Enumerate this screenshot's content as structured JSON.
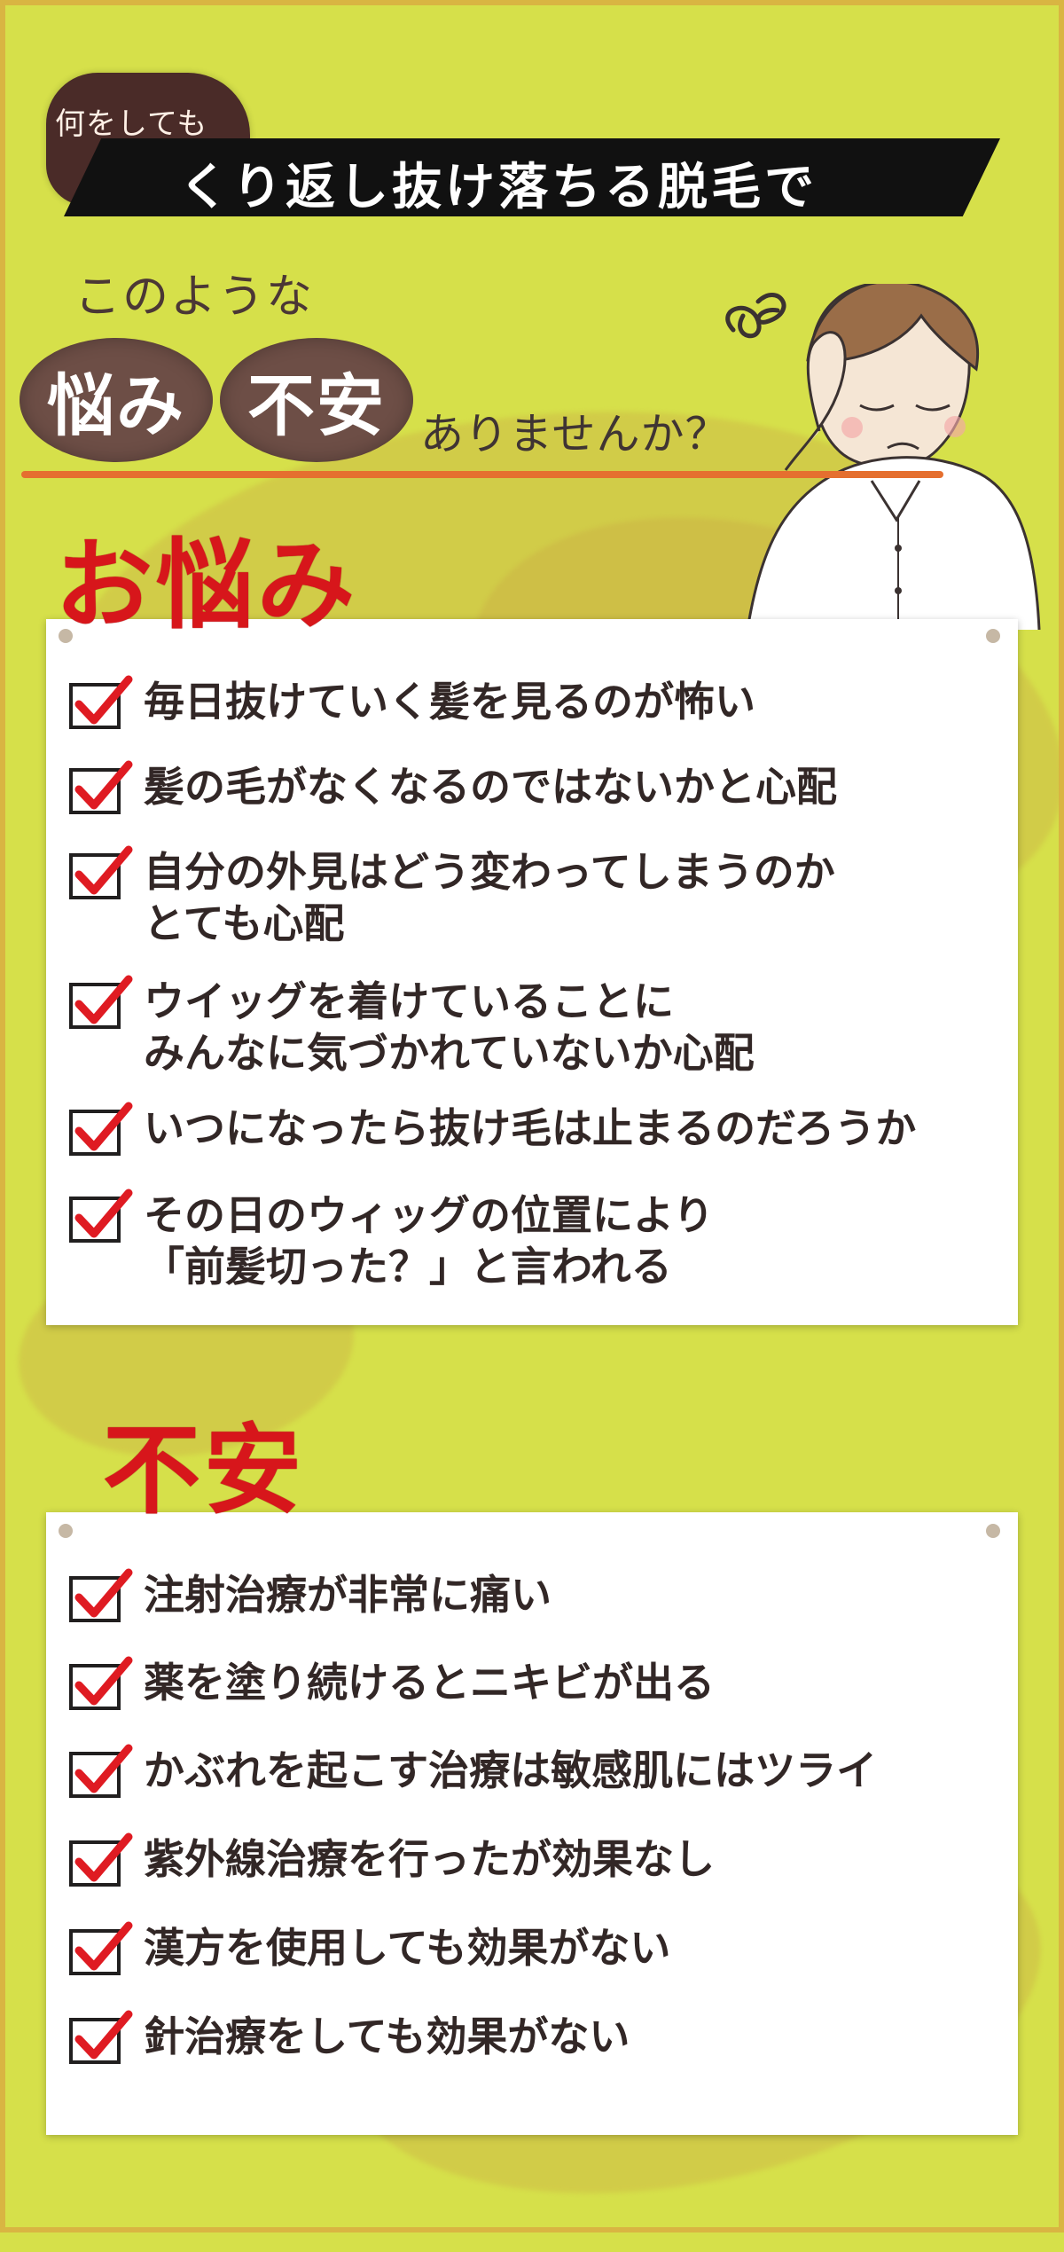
{
  "header": {
    "small_tag": "何をしても",
    "banner_title": "くり返し抜け落ちる脱毛で",
    "intro_text": "このような",
    "circle_words": [
      "悩み",
      "不安"
    ],
    "question": "ありませんか？"
  },
  "sections": {
    "worries": {
      "title": "お悩み",
      "items": [
        "毎日抜けていく髪を見るのが怖い",
        "髪の毛がなくなるのではないかと心配",
        "自分の外見はどう変わってしまうのか\nとても心配",
        "ウイッグを着けていることに\nみんなに気づかれていないか心配",
        "いつになったら抜け毛は止まるのだろうか",
        "その日のウィッグの位置により\n「前髪切った？」と言われる"
      ]
    },
    "anxieties": {
      "title": "不安",
      "items": [
        "注射治療が非常に痛い",
        "薬を塗り続けるとニキビが出る",
        "かぶれを起こす治療は敏感肌にはツライ",
        "紫外線治療を行ったが効果なし",
        "漢方を使用しても効果がない",
        "針治療をしても効果がない"
      ]
    }
  },
  "colors": {
    "background": "#d6e04a",
    "accent_red": "#d7161b",
    "brown_circle": "#6d4e46",
    "banner_black": "#111111",
    "underline_orange": "#e56f2f",
    "frame_gold": "#d9b542"
  },
  "icons": {
    "checkbox": "red-check-mark-in-box",
    "character": "worried-man-illustration"
  }
}
